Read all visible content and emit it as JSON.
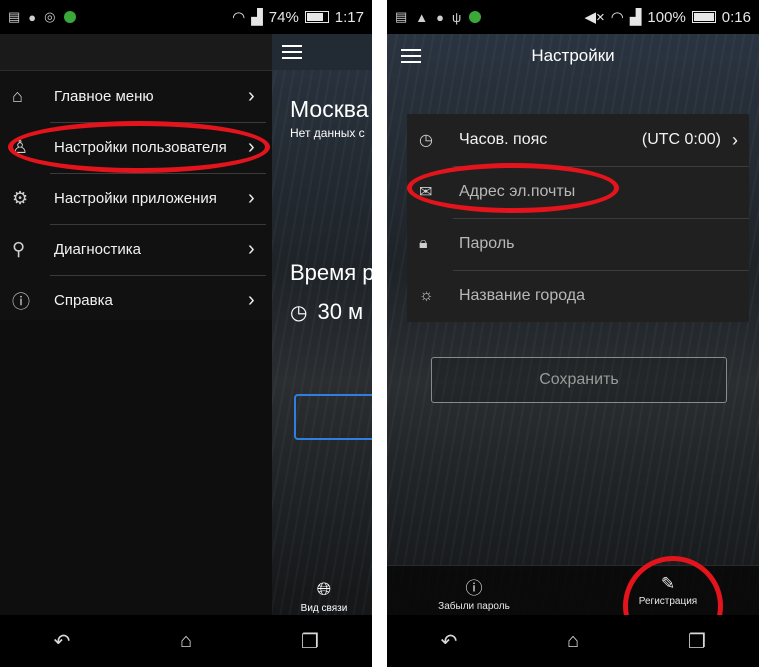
{
  "left": {
    "status": {
      "battery": "74%",
      "time": "1:17"
    },
    "drawer": {
      "items": [
        {
          "label": "Главное меню",
          "icon": "home-icon"
        },
        {
          "label": "Настройки пользователя",
          "icon": "user-icon"
        },
        {
          "label": "Настройки приложения",
          "icon": "gear-icon"
        },
        {
          "label": "Диагностика",
          "icon": "search-icon"
        },
        {
          "label": "Справка",
          "icon": "help-icon"
        }
      ]
    },
    "content": {
      "city": "Москва",
      "no_data": "Нет данных с",
      "time_title": "Время р",
      "time_value": "30 м",
      "connection_label": "Вид связи"
    }
  },
  "right": {
    "status": {
      "battery": "100%",
      "time": "0:16"
    },
    "title": "Настройки",
    "rows": [
      {
        "label": "Часов. пояс",
        "value": "(UTC 0:00)",
        "icon": "clock-icon"
      },
      {
        "label": "Адрес эл.почты",
        "icon": "envelope-icon"
      },
      {
        "label": "Пароль",
        "icon": "lock-icon"
      },
      {
        "label": "Название города",
        "icon": "weather-icon"
      }
    ],
    "save_label": "Сохранить",
    "forgot_label": "Забыли пароль",
    "register_label": "Регистрация"
  },
  "colors": {
    "highlight": "#e3141b",
    "accent_blue": "#2f7fe0"
  }
}
